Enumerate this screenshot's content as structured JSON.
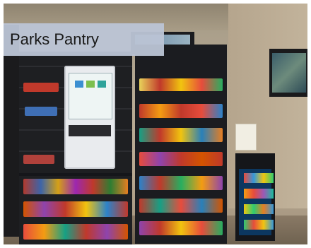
{
  "caption": {
    "text": "Parks Pantry"
  },
  "photo": {
    "subject": "micro-market",
    "objects": [
      "snack-rack",
      "self-checkout-kiosk",
      "snack-cabinet",
      "beverage-fridge",
      "wall-tv",
      "menu-sign"
    ]
  },
  "colors": {
    "label_bg": "#bcc5d6",
    "rack": "#1e1f22",
    "wall": "#b8a992",
    "fridge_glow": "#0c3760"
  }
}
